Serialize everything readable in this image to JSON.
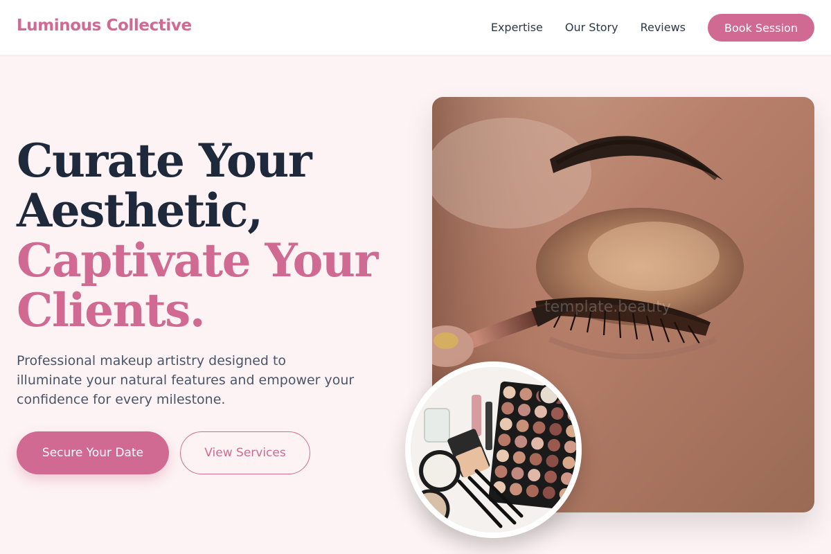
{
  "nav": {
    "brand": "Luminous Collective",
    "links": [
      "Expertise",
      "Our Story",
      "Reviews"
    ],
    "cta": "Book Session"
  },
  "hero": {
    "title_line1": "Curate Your",
    "title_line2": "Aesthetic,",
    "title_line3": "Captivate Your",
    "title_line4": "Clients.",
    "description_line1": "Professional makeup artistry designed to",
    "description_line2": "illuminate your natural features and empower your",
    "description_line3": "confidence for every milestone.",
    "primary_button": "Secure Your Date",
    "secondary_button": "View Services"
  },
  "colors": {
    "accent": "#d16a92",
    "heading": "#1e2a3b",
    "background": "#fdf3f4"
  }
}
